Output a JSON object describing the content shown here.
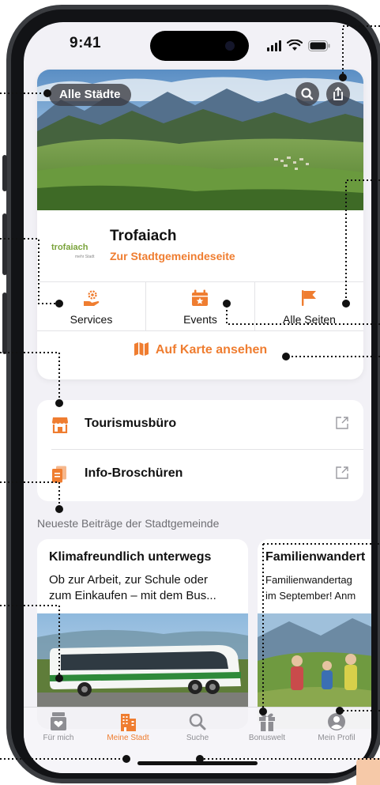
{
  "status_bar": {
    "time": "9:41"
  },
  "header": {
    "city_chip": "Alle Städte",
    "search_icon": "search-icon",
    "share_icon": "share-icon"
  },
  "town": {
    "name": "Trofaiach",
    "link": "Zur Stadtgemeindeseite",
    "logo_text": "trofaiach",
    "logo_sub": "mehr Stadt"
  },
  "categories": [
    {
      "label": "Services",
      "icon": "services-hand-gear-icon"
    },
    {
      "label": "Events",
      "icon": "calendar-star-icon"
    },
    {
      "label": "Alle Seiten",
      "icon": "flag-icon"
    }
  ],
  "map_link": "Auf Karte ansehen",
  "links": [
    {
      "label": "Tourismusbüro",
      "icon": "storefront-icon"
    },
    {
      "label": "Info-Broschüren",
      "icon": "brochure-icon"
    }
  ],
  "section_title": "Neueste Beiträge der Stadtgemeinde",
  "posts": [
    {
      "title": "Klimafreundlich unterwegs",
      "text_line1": "Ob zur Arbeit, zur Schule oder",
      "text_line2": "zum Einkaufen – mit dem Bus..."
    },
    {
      "title": "Familienwandert",
      "text_line1": "Familienwandertag",
      "text_line2": "im September! Anm"
    }
  ],
  "tabs": [
    {
      "label": "Für mich",
      "icon": "gift-heart-icon",
      "active": false
    },
    {
      "label": "Meine Stadt",
      "icon": "city-buildings-icon",
      "active": true
    },
    {
      "label": "Suche",
      "icon": "search-icon",
      "active": false
    },
    {
      "label": "Bonuswelt",
      "icon": "gift-icon",
      "active": false
    },
    {
      "label": "Mein Profil",
      "icon": "profile-icon",
      "active": false
    }
  ],
  "colors": {
    "accent": "#ef7d30",
    "background": "#f2f1f6",
    "tab_inactive": "#8e8e93"
  }
}
